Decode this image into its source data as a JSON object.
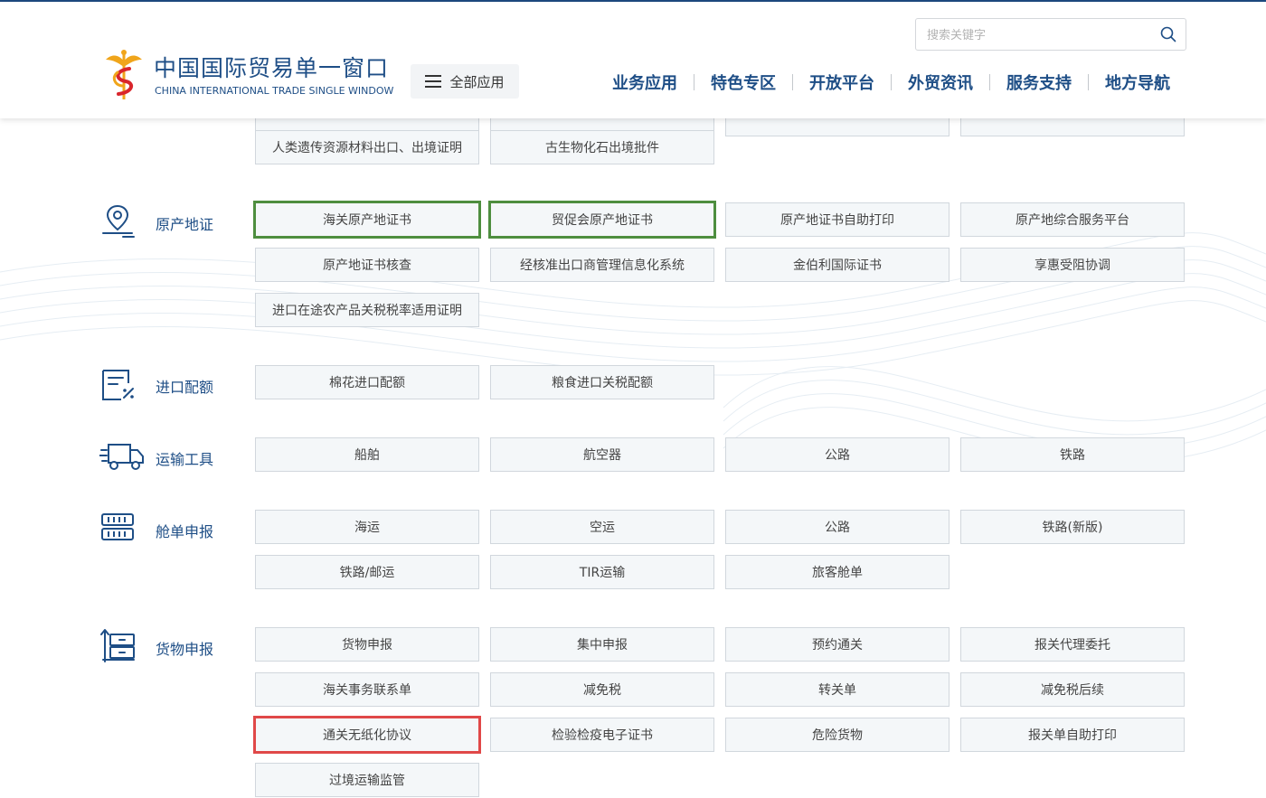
{
  "header": {
    "brand_cn": "中国国际贸易单一窗口",
    "brand_en": "CHINA INTERNATIONAL TRADE SINGLE WINDOW",
    "all_apps": "全部应用",
    "search_placeholder": "搜索关键字",
    "nav": [
      "业务应用",
      "特色专区",
      "开放平台",
      "外贸资讯",
      "服务支持",
      "地方导航"
    ]
  },
  "sections": {
    "prev": {
      "items": [
        "人类遗传资源材料出口、出境证明",
        "古生物化石出境批件"
      ]
    },
    "origin": {
      "label": "原产地证",
      "items": [
        "海关原产地证书",
        "贸促会原产地证书",
        "原产地证书自助打印",
        "原产地综合服务平台",
        "原产地证书核查",
        "经核准出口商管理信息化系统",
        "金伯利国际证书",
        "享惠受阻协调",
        "进口在途农产品关税税率适用证明"
      ]
    },
    "quota": {
      "label": "进口配额",
      "items": [
        "棉花进口配额",
        "粮食进口关税配额"
      ]
    },
    "transport": {
      "label": "运输工具",
      "items": [
        "船舶",
        "航空器",
        "公路",
        "铁路"
      ]
    },
    "manifest": {
      "label": "舱单申报",
      "items": [
        "海运",
        "空运",
        "公路",
        "铁路(新版)",
        "铁路/邮运",
        "TIR运输",
        "旅客舱单"
      ]
    },
    "goods": {
      "label": "货物申报",
      "items": [
        "货物申报",
        "集中申报",
        "预约通关",
        "报关代理委托",
        "海关事务联系单",
        "减免税",
        "转关单",
        "减免税后续",
        "通关无纸化协议",
        "检验检疫电子证书",
        "危险货物",
        "报关单自助打印",
        "过境运输监管"
      ]
    }
  },
  "colors": {
    "brand": "#1e4e86",
    "highlight_green": "#4e8e3f",
    "highlight_red": "#e04848"
  }
}
